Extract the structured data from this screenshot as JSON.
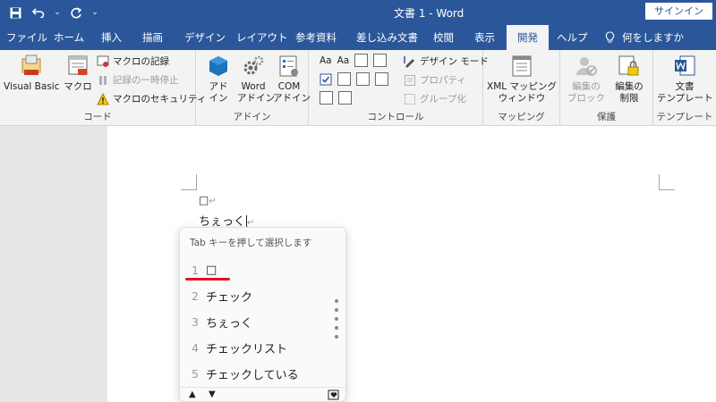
{
  "titlebar": {
    "title": "文書 1  -  Word",
    "signin": "サインイン",
    "qat_dropdown": "⌄"
  },
  "tabs": {
    "file": "ファイル",
    "home": "ホーム",
    "insert": "挿入",
    "draw": "描画",
    "design": "デザイン",
    "layout": "レイアウト",
    "references": "参考資料",
    "mailings": "差し込み文書",
    "review": "校閲",
    "view": "表示",
    "developer": "開発",
    "help": "ヘルプ",
    "tell_me": "何をしますか"
  },
  "ribbon": {
    "code": {
      "label": "コード",
      "visual_basic": "Visual Basic",
      "macro": "マクロ",
      "record_macro": "マクロの記録",
      "pause_recording": "記録の一時停止",
      "macro_security": "マクロのセキュリティ"
    },
    "addins": {
      "label": "アドイン",
      "addin_line1": "アド",
      "addin_line2": "イン",
      "word_addin_line1": "Word",
      "word_addin_line2": "アドイン",
      "com_addin_line1": "COM",
      "com_addin_line2": "アドイン"
    },
    "controls": {
      "label": "コントロール",
      "text_aa1": "Aa",
      "text_aa2": "Aa",
      "design_mode": "デザイン モード",
      "properties": "プロパティ",
      "group": "グループ化"
    },
    "mapping": {
      "label": "マッピング",
      "xml_line1": "XML マッピング",
      "xml_line2": "ウィンドウ"
    },
    "protect": {
      "label": "保護",
      "block_line1": "編集の",
      "block_line2": "ブロック",
      "restrict_line1": "編集の",
      "restrict_line2": "制限"
    },
    "templates": {
      "label": "テンプレート",
      "doc_template_line1": "文書",
      "doc_template_line2": "テンプレート"
    }
  },
  "document": {
    "line1_text": "□",
    "line2_text": "ちぇっく",
    "return_mark": "↵"
  },
  "ime": {
    "hint": "Tab キーを押して選択します",
    "candidates": [
      {
        "num": "1",
        "text": "□"
      },
      {
        "num": "2",
        "text": "チェック"
      },
      {
        "num": "3",
        "text": "ちぇっく"
      },
      {
        "num": "4",
        "text": "チェックリスト"
      },
      {
        "num": "5",
        "text": "チェックしている"
      }
    ],
    "up_arrow": "▲",
    "down_arrow": "▼"
  },
  "colors": {
    "word_blue": "#2b579a",
    "selection_underline": "#e81123"
  }
}
